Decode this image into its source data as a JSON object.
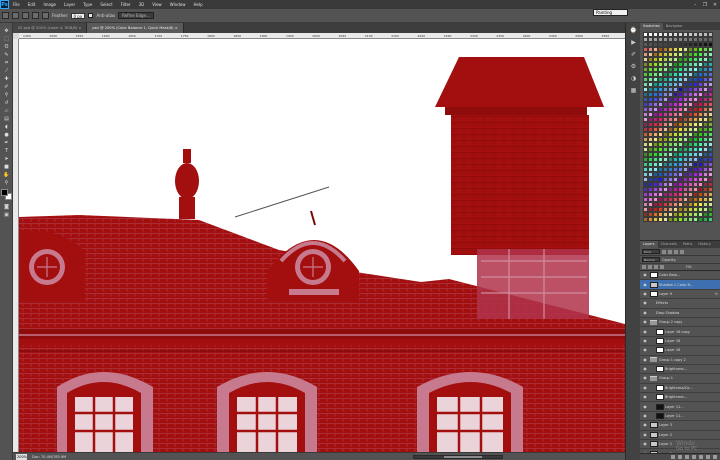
{
  "app": {
    "logo": "Ps"
  },
  "menu": [
    "File",
    "Edit",
    "Image",
    "Layer",
    "Type",
    "Select",
    "Filter",
    "3D",
    "View",
    "Window",
    "Help"
  ],
  "window_controls": [
    "minimize",
    "restore",
    "close"
  ],
  "options_bar": {
    "feather_label": "Feather:",
    "feather_value": "0 px",
    "antialias_label": "Anti-alias",
    "refine_button": "Refine Edge..."
  },
  "workspace": "Painting",
  "document_tabs": [
    {
      "label": "02.psd @ 200% (Layer 4, RGB/8) ×",
      "active": false
    },
    {
      "label": "psd @ 200% (Color Balance 1, Quick Mask/8) ×",
      "active": true
    }
  ],
  "tools": [
    "move-tool",
    "marquee-tool",
    "lasso-tool",
    "quick-select-tool",
    "crop-tool",
    "eyedropper-tool",
    "healing-tool",
    "brush-tool",
    "clone-tool",
    "history-brush-tool",
    "eraser-tool",
    "gradient-tool",
    "blur-tool",
    "dodge-tool",
    "pen-tool",
    "type-tool",
    "path-select-tool",
    "shape-tool",
    "hand-tool",
    "zoom-tool"
  ],
  "ruler_ticks": [
    "1450",
    "1500",
    "1550",
    "1600",
    "1650",
    "1700",
    "1750",
    "1800",
    "1850",
    "1900",
    "1950",
    "2000",
    "2050",
    "2100",
    "2150",
    "2200",
    "2250",
    "2300",
    "2350",
    "2400",
    "2450",
    "2500",
    "2550"
  ],
  "status": {
    "zoom": "200%",
    "doc": "Doc: 70.4M/785.9M"
  },
  "panels": {
    "top_tabs": [
      "Swatches",
      "Navigator"
    ],
    "layers_tabs": [
      "Layers",
      "Channels",
      "Paths",
      "History"
    ],
    "filter_label": "Kind",
    "blend_mode": "Normal",
    "opacity_label": "Opacity:",
    "fill_label": "Fill:"
  },
  "layers": [
    {
      "name": "Color Bala...",
      "eye": true,
      "thumb": "white",
      "indent": 0,
      "active": false
    },
    {
      "name": "Shadow 1 Color B...",
      "eye": true,
      "thumb": "grey",
      "indent": 0,
      "active": true
    },
    {
      "name": "Layer 9",
      "eye": true,
      "thumb": "white",
      "indent": 0,
      "fx": "fx"
    },
    {
      "name": "Effects",
      "eye": true,
      "thumb": "none",
      "indent": 1
    },
    {
      "name": "Drop Shadow",
      "eye": true,
      "thumb": "none",
      "indent": 1
    },
    {
      "name": "Group 2 copy",
      "eye": true,
      "thumb": "folder",
      "indent": 0
    },
    {
      "name": "Layer 16 copy",
      "eye": true,
      "thumb": "white",
      "indent": 1
    },
    {
      "name": "Layer 16",
      "eye": true,
      "thumb": "white",
      "indent": 1
    },
    {
      "name": "Layer 16",
      "eye": true,
      "thumb": "white",
      "indent": 1
    },
    {
      "name": "Group 1 copy 2",
      "eye": true,
      "thumb": "folder",
      "indent": 0
    },
    {
      "name": "Brightness...",
      "eye": true,
      "thumb": "white",
      "indent": 1
    },
    {
      "name": "Group 1",
      "eye": true,
      "thumb": "folder",
      "indent": 0
    },
    {
      "name": "Brightness/Co...",
      "eye": true,
      "thumb": "white",
      "indent": 1
    },
    {
      "name": "Brightness...",
      "eye": true,
      "thumb": "white",
      "indent": 1
    },
    {
      "name": "Layer 11...",
      "eye": true,
      "thumb": "dark",
      "indent": 1
    },
    {
      "name": "Layer 11...",
      "eye": true,
      "thumb": "dark",
      "indent": 1
    },
    {
      "name": "Layer 3",
      "eye": true,
      "thumb": "grey",
      "indent": 0
    },
    {
      "name": "Layer 2",
      "eye": true,
      "thumb": "grey",
      "indent": 0
    },
    {
      "name": "Layer 1",
      "eye": true,
      "thumb": "grey",
      "indent": 0
    },
    {
      "name": "Layer 1",
      "eye": true,
      "thumb": "grey",
      "indent": 0
    }
  ],
  "watermark": {
    "line1": "Windo",
    "line2": "Go to PC"
  },
  "colors": {
    "mask": "#a30e0e",
    "mask_light": "#c77a8e",
    "canvas": "#ffffff",
    "ui_dark": "#3a3a3a",
    "ui_mid": "#535353"
  }
}
